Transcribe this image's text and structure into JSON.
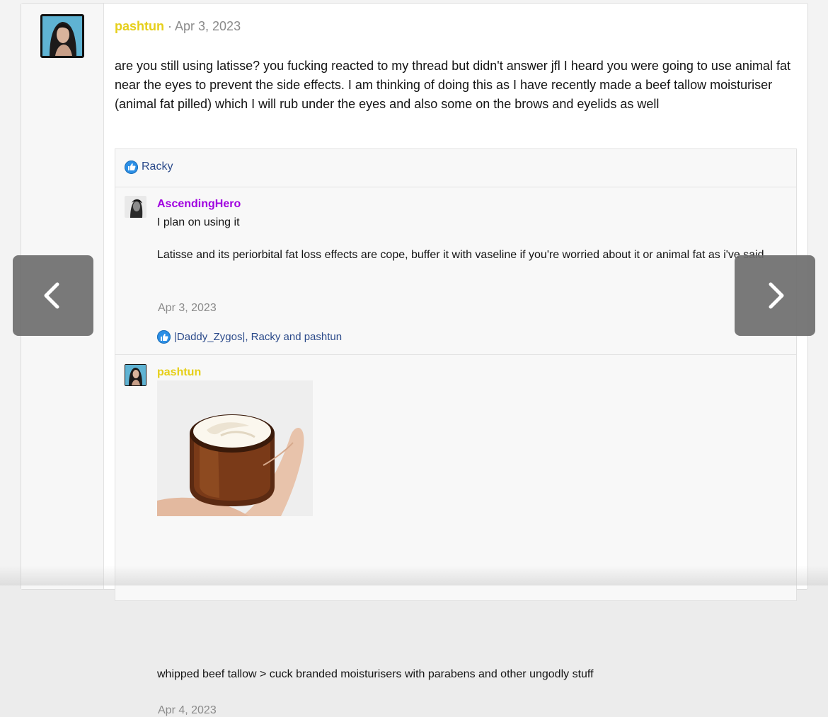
{
  "post": {
    "author": "pashtun",
    "date": "Apr 3, 2023",
    "date_separator": " · ",
    "body": "are you still using latisse? you fucking reacted to my thread but didn't answer jfl I heard you were going to use animal fat near the eyes to prevent the side effects. I am thinking of doing this as I have recently made a beef tallow moisturiser (animal fat pilled) which I will rub under the eyes and also some on the brows and eyelids as well"
  },
  "reactions": {
    "icon": "like-icon",
    "names": "Racky"
  },
  "comments": [
    {
      "author": "AscendingHero",
      "author_color": "#a000e0",
      "line1": "I plan on using it",
      "line2": "Latisse and its periorbital fat loss effects are cope, buffer it with vaseline if you're worried about it or animal fat as i've said",
      "date": "Apr 3, 2023",
      "reactions": "|Daddy_Zygos|, Racky and pashtun"
    },
    {
      "author": "pashtun",
      "author_color": "#e6cf1a",
      "text": "whipped beef tallow > cuck branded moisturisers with parabens and other ungodly stuff",
      "date": "Apr 4, 2023",
      "attachment": "photo of hand holding amber jar of whipped beef tallow"
    }
  ],
  "nav": {
    "prev_icon": "chevron-left-icon",
    "next_icon": "chevron-right-icon"
  },
  "colors": {
    "username": "#e6cf1a",
    "link": "#2b4a8a",
    "like": "#2b8fe6"
  }
}
